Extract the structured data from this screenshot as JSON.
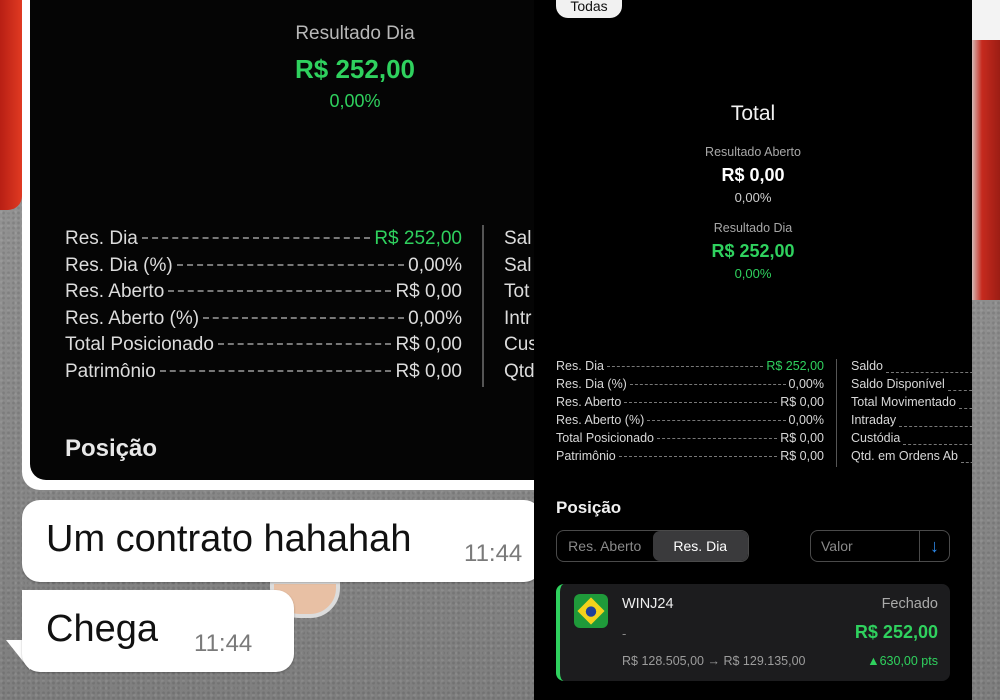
{
  "left": {
    "resultado_label": "Resultado Dia",
    "resultado_value": "R$ 252,00",
    "resultado_pct": "0,00%",
    "rows": [
      {
        "label": "Res. Dia",
        "value": "R$ 252,00",
        "green": true
      },
      {
        "label": "Res. Dia (%)",
        "value": "0,00%"
      },
      {
        "label": "Res. Aberto",
        "value": "R$ 0,00"
      },
      {
        "label": "Res. Aberto (%)",
        "value": "0,00%"
      },
      {
        "label": "Total Posicionado",
        "value": "R$ 0,00"
      },
      {
        "label": "Patrimônio",
        "value": "R$ 0,00"
      }
    ],
    "right_col": [
      "Sal",
      "Sal",
      "Tot",
      "Intr",
      "Cus",
      "Qtd"
    ],
    "posicao": "Posição"
  },
  "chat": {
    "msg1": "Um contrato hahahah",
    "time1": "11:44",
    "msg2": "Chega",
    "time2": "11:44"
  },
  "right": {
    "filter": "Todas",
    "total": "Total",
    "aberto_label": "Resultado Aberto",
    "aberto_value": "R$ 0,00",
    "aberto_pct": "0,00%",
    "dia_label": "Resultado Dia",
    "dia_value": "R$ 252,00",
    "dia_pct": "0,00%",
    "rows": [
      {
        "label": "Res. Dia",
        "value": "R$ 252,00",
        "green": true
      },
      {
        "label": "Res. Dia (%)",
        "value": "0,00%"
      },
      {
        "label": "Res. Aberto",
        "value": "R$ 0,00"
      },
      {
        "label": "Res. Aberto (%)",
        "value": "0,00%"
      },
      {
        "label": "Total Posicionado",
        "value": "R$ 0,00"
      },
      {
        "label": "Patrimônio",
        "value": "R$ 0,00"
      }
    ],
    "right_col": [
      "Saldo",
      "Saldo Disponível",
      "Total Movimentado",
      "Intraday",
      "Custódia",
      "Qtd. em Ordens Ab"
    ],
    "posicao": "Posição",
    "seg_options": [
      "Res. Aberto",
      "Res. Dia"
    ],
    "seg_active": 1,
    "sort_label": "Valor",
    "sort_icon": "↓",
    "card": {
      "symbol": "WINJ24",
      "status": "Fechado",
      "dash": "-",
      "amount": "R$ 252,00",
      "prices": "R$ 128.505,00 → R$ 129.135,00",
      "pts": "▲630,00 pts"
    }
  }
}
